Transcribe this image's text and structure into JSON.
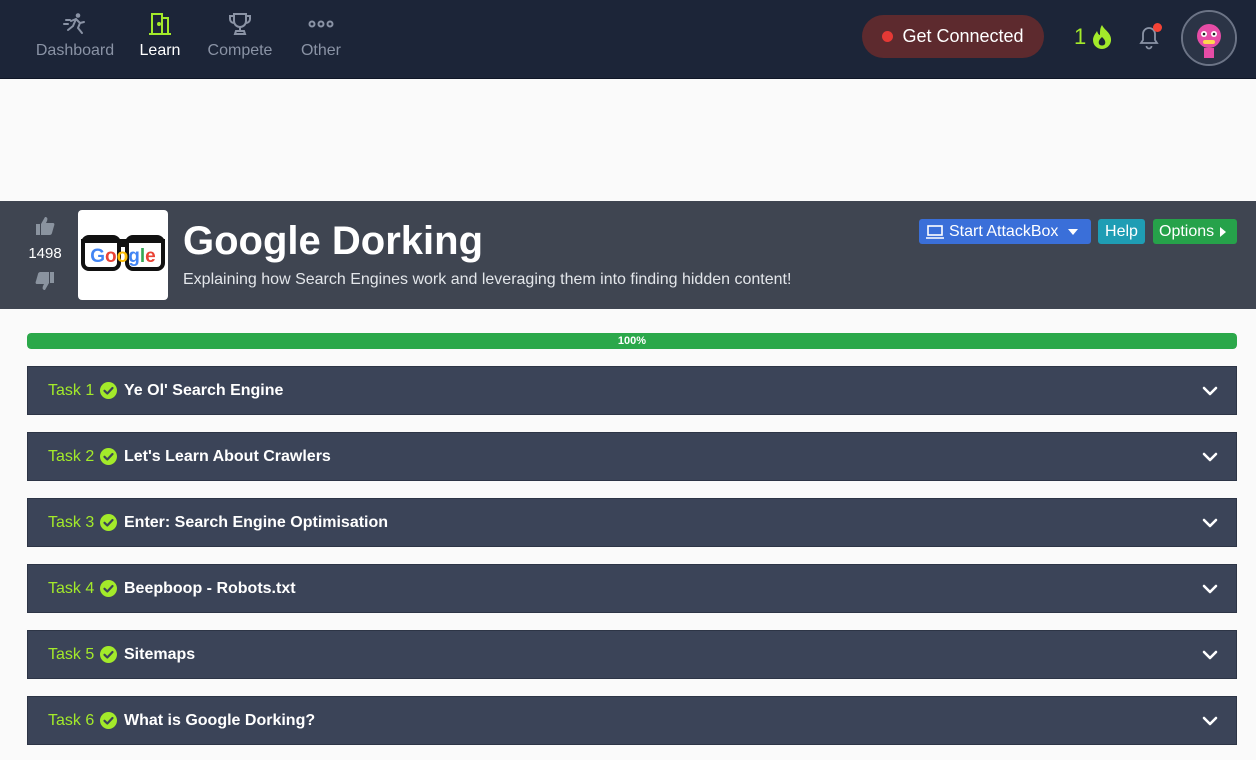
{
  "nav": {
    "items": [
      {
        "label": "Dashboard",
        "icon": "running-person-icon",
        "active": false
      },
      {
        "label": "Learn",
        "icon": "door-icon",
        "active": true
      },
      {
        "label": "Compete",
        "icon": "trophy-icon",
        "active": false
      },
      {
        "label": "Other",
        "icon": "ellipsis-icon",
        "active": false
      }
    ],
    "get_connected": "Get Connected",
    "streak_count": "1"
  },
  "room": {
    "votes": "1498",
    "logo_text": "Google",
    "title": "Google Dorking",
    "description": "Explaining how Search Engines work and leveraging them into finding hidden content!",
    "buttons": {
      "attackbox": "Start AttackBox",
      "help": "Help",
      "options": "Options"
    }
  },
  "progress": {
    "value": 100,
    "label": "100%"
  },
  "tasks": [
    {
      "number": "Task 1",
      "title": "Ye Ol' Search Engine",
      "complete": true
    },
    {
      "number": "Task 2",
      "title": "Let's Learn About Crawlers",
      "complete": true
    },
    {
      "number": "Task 3",
      "title": "Enter: Search Engine Optimisation",
      "complete": true
    },
    {
      "number": "Task 4",
      "title": "Beepboop - Robots.txt",
      "complete": true
    },
    {
      "number": "Task 5",
      "title": "Sitemaps",
      "complete": true
    },
    {
      "number": "Task 6",
      "title": "What is Google Dorking?",
      "complete": true
    }
  ],
  "colors": {
    "accent_green": "#a3ea2a",
    "nav_bg": "#1c2538",
    "task_bg": "#3b4458",
    "progress_green": "#2ba84a"
  }
}
